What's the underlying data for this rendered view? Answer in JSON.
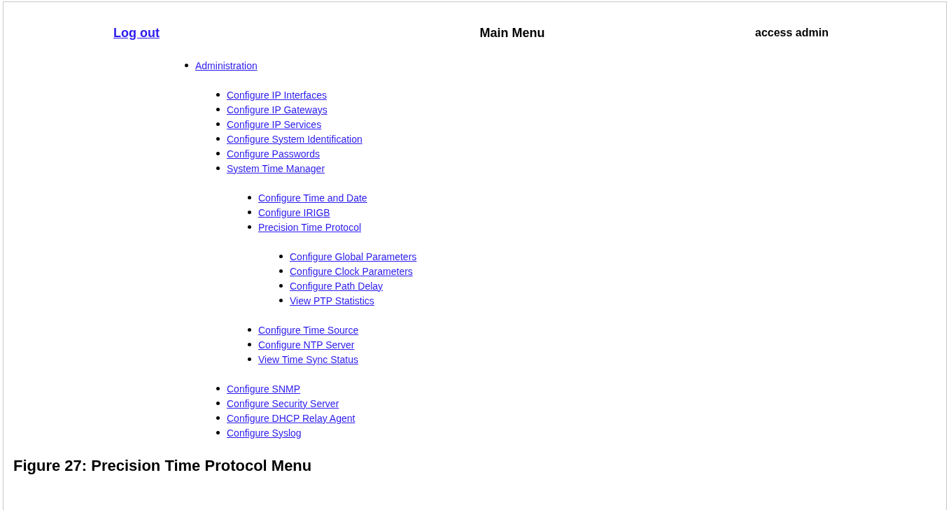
{
  "header": {
    "logout_link": "Log out",
    "title": "Main Menu",
    "user": "access admin"
  },
  "menu": [
    {
      "label": "Administration",
      "children": [
        {
          "label": "Configure IP Interfaces"
        },
        {
          "label": "Configure IP Gateways"
        },
        {
          "label": "Configure IP Services"
        },
        {
          "label": "Configure System Identification"
        },
        {
          "label": "Configure Passwords"
        },
        {
          "label": "System Time Manager",
          "children": [
            {
              "label": "Configure Time and Date"
            },
            {
              "label": "Configure IRIGB"
            },
            {
              "label": "Precision Time Protocol",
              "children": [
                {
                  "label": "Configure Global Parameters"
                },
                {
                  "label": "Configure Clock Parameters"
                },
                {
                  "label": "Configure Path Delay"
                },
                {
                  "label": "View PTP Statistics"
                }
              ]
            },
            {
              "label": "Configure Time Source"
            },
            {
              "label": "Configure NTP Server"
            },
            {
              "label": "View Time Sync Status"
            }
          ]
        },
        {
          "label": "Configure SNMP"
        },
        {
          "label": "Configure Security Server"
        },
        {
          "label": "Configure DHCP Relay Agent"
        },
        {
          "label": "Configure Syslog"
        }
      ]
    }
  ],
  "caption": "Figure 27: Precision Time Protocol Menu"
}
